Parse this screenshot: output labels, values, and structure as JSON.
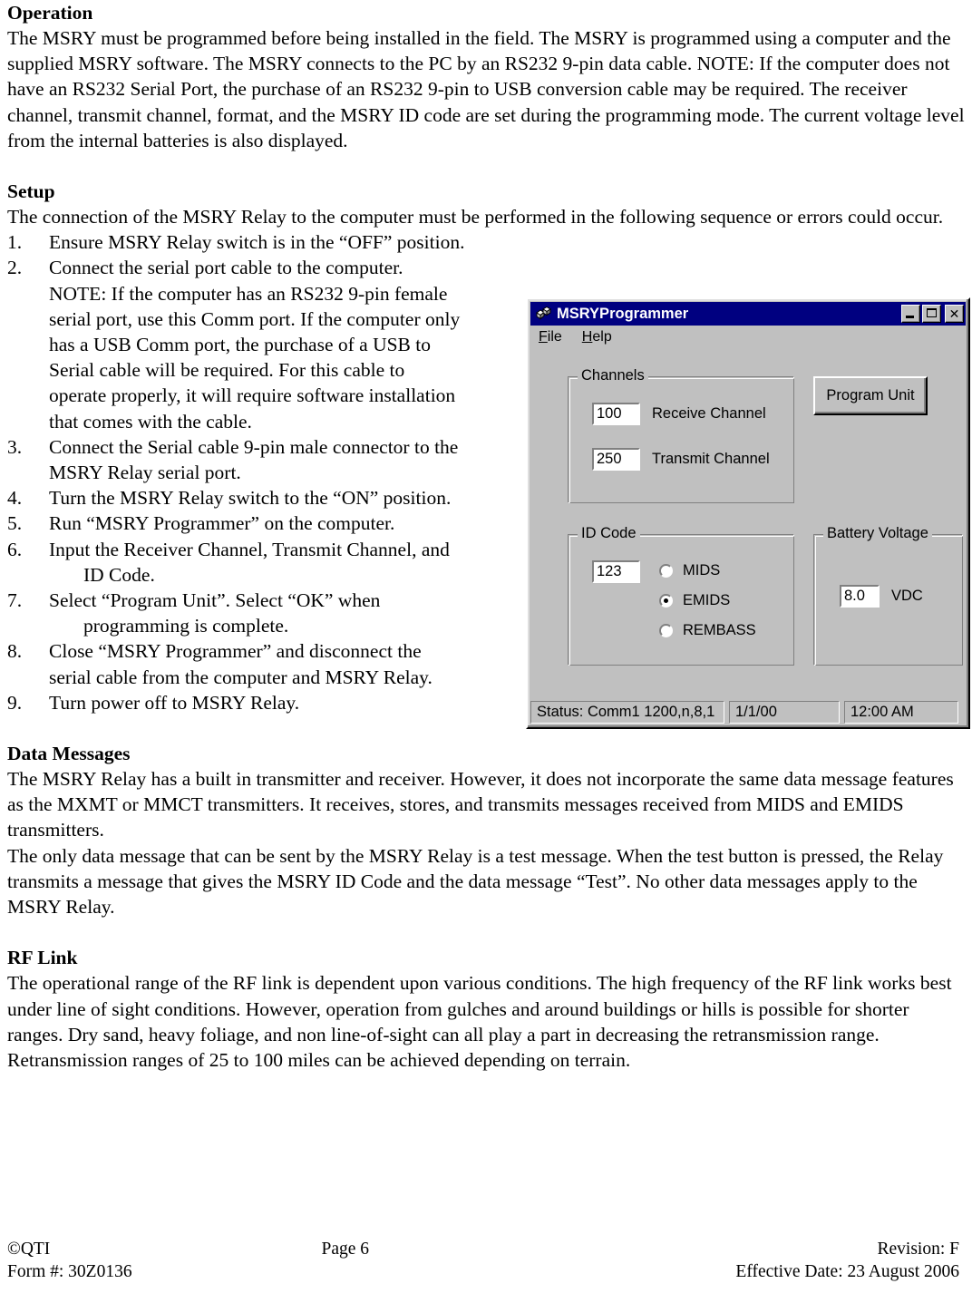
{
  "document": {
    "sections": [
      {
        "heading": "Operation",
        "paragraphs": [
          "The MSRY must be programmed before being installed in the field. The MSRY is programmed using a computer and the supplied MSRY software.  The MSRY connects to the PC by an RS232 9-pin data cable.  NOTE: If the computer does not have an RS232 Serial Port, the purchase of an RS232 9-pin to USB conversion cable may be required.  The receiver channel, transmit channel, format, and the MSRY ID code are set during the programming mode.  The current voltage level from the internal batteries is also displayed."
        ]
      },
      {
        "heading": "Setup",
        "paragraphs": [
          "The connection of the MSRY Relay to the computer must be performed in the following sequence or errors could occur."
        ]
      },
      {
        "heading": "Data Messages",
        "paragraphs": [
          "The MSRY Relay has a built in transmitter and receiver. However, it does not incorporate the same data message features as the MXMT or MMCT transmitters.  It receives, stores, and transmits messages received from MIDS and EMIDS transmitters.",
          "The only data message that can be sent by the MSRY Relay is a test message.  When the test button is pressed, the Relay transmits a message that gives the MSRY ID Code and the data message “Test”.  No other data messages apply to the MSRY Relay."
        ]
      },
      {
        "heading": "RF Link",
        "paragraphs": [
          "The operational range of the RF link is dependent upon various conditions.  The high frequency of the RF link works best under line of sight conditions.  However, operation from gulches and around buildings or hills is possible for shorter ranges.  Dry sand, heavy foliage, and non line-of-sight can all play a part in decreasing the retransmission range.  Retransmission ranges of 25 to 100 miles can be achieved depending on terrain."
        ]
      }
    ],
    "setup_steps": [
      {
        "num": "1.",
        "lines": [
          {
            "text": "Ensure MSRY Relay switch is in the “OFF” position.",
            "indent": false
          }
        ]
      },
      {
        "num": "2.",
        "lines": [
          {
            "text": "Connect the serial port cable to the computer.",
            "indent": false
          },
          {
            "text": "NOTE: If the computer has an RS232 9-pin female",
            "indent": false
          },
          {
            "text": "serial port, use this Comm port.  If the computer only",
            "indent": false
          },
          {
            "text": "has a USB Comm port, the purchase of a USB to",
            "indent": false
          },
          {
            "text": "Serial cable will be required.  For this cable to",
            "indent": false
          },
          {
            "text": "operate properly, it will require software installation",
            "indent": false
          },
          {
            "text": "that comes with the cable.",
            "indent": false
          }
        ]
      },
      {
        "num": "3.",
        "lines": [
          {
            "text": "Connect the Serial cable 9-pin male connector to the",
            "indent": false
          },
          {
            "text": "MSRY Relay serial port.",
            "indent": false
          }
        ]
      },
      {
        "num": "4.",
        "lines": [
          {
            "text": "Turn the MSRY Relay switch to the “ON” position.",
            "indent": false
          }
        ]
      },
      {
        "num": "5.",
        "lines": [
          {
            "text": "Run “MSRY Programmer” on the computer.",
            "indent": false
          }
        ]
      },
      {
        "num": "6.",
        "lines": [
          {
            "text": "Input the Receiver Channel, Transmit Channel, and",
            "indent": false
          },
          {
            "text": "ID Code.",
            "indent": true
          }
        ]
      },
      {
        "num": "7.",
        "lines": [
          {
            "text": "Select “Program Unit”.  Select “OK” when",
            "indent": false
          },
          {
            "text": "programming is complete.",
            "indent": true
          }
        ]
      },
      {
        "num": "8.",
        "lines": [
          {
            "text": "Close “MSRY Programmer” and disconnect the",
            "indent": false
          },
          {
            "text": "serial cable from the computer and MSRY Relay.",
            "indent": false
          }
        ]
      },
      {
        "num": "9.",
        "lines": [
          {
            "text": "Turn power off to MSRY Relay.",
            "indent": false
          }
        ]
      }
    ],
    "footer": {
      "copyright": "©QTI",
      "page": "Page 6",
      "revision": "Revision: F",
      "form": "Form #: 30Z0136",
      "effective_date": "Effective Date: 23 August 2006"
    }
  },
  "dialog": {
    "title": "MSRYProgrammer",
    "icon": "app-device-icon",
    "window_controls": {
      "minimize": "minimize-icon",
      "maximize": "maximize-icon",
      "close": "close-icon",
      "close_glyph": "✕"
    },
    "menu": [
      {
        "label": "File",
        "accel": "F"
      },
      {
        "label": "Help",
        "accel": "H"
      }
    ],
    "channels_group": {
      "label": "Channels",
      "receive": {
        "value": "100",
        "label": "Receive Channel"
      },
      "transmit": {
        "value": "250",
        "label": "Transmit Channel"
      }
    },
    "idcode_group": {
      "label": "ID Code",
      "value": "123",
      "options": [
        {
          "label": "MIDS",
          "selected": false
        },
        {
          "label": "EMIDS",
          "selected": true
        },
        {
          "label": "REMBASS",
          "selected": false
        }
      ]
    },
    "battery_group": {
      "label": "Battery Voltage",
      "value": "8.0",
      "unit": "VDC"
    },
    "program_button": "Program Unit",
    "statusbar": {
      "status": "Status: Comm1 1200,n,8,1",
      "date": "1/1/00",
      "time": "12:00 AM"
    },
    "colors": {
      "titlebar": "#000080",
      "face": "#c0c0c0",
      "shadow": "#808080",
      "highlight": "#ffffff",
      "text": "#000000",
      "field": "#ffffff"
    }
  }
}
